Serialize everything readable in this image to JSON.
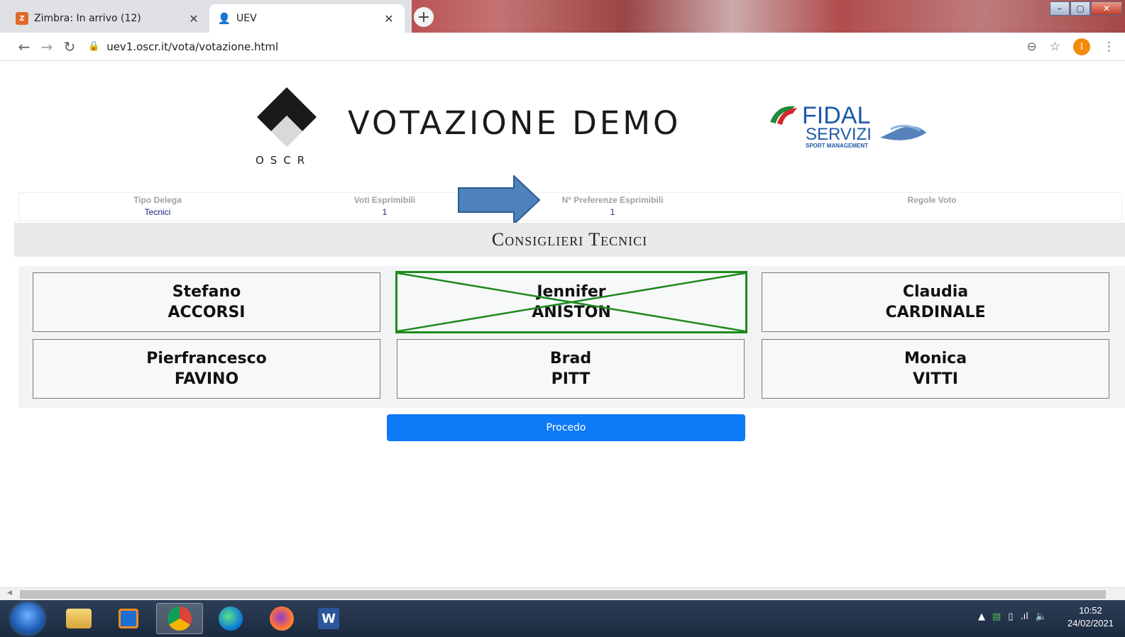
{
  "browser": {
    "tabs": [
      {
        "title": "Zimbra: In arrivo (12)",
        "active": false,
        "icon": "zimbra-icon"
      },
      {
        "title": "UEV",
        "active": true,
        "icon": "user-check-icon"
      }
    ],
    "url": "uev1.oscr.it/vota/votazione.html",
    "profile_initial": "I"
  },
  "header": {
    "logo_text": "OSCR",
    "title": "VOTAZIONE DEMO",
    "partner_logo": {
      "line1": "FIDAL",
      "line2": "SERVIZI",
      "line3": "SPORT MANAGEMENT"
    }
  },
  "info": [
    {
      "label": "Tipo Delega",
      "value": "Tecnici"
    },
    {
      "label": "Voti Esprimibili",
      "value": "1"
    },
    {
      "label": "N° Preferenze Esprimibili",
      "value": "1"
    },
    {
      "label": "Regole Voto",
      "value": ""
    }
  ],
  "section": {
    "title": "Consiglieri Tecnici"
  },
  "candidates": [
    {
      "first": "Stefano",
      "last": "ACCORSI",
      "selected": false
    },
    {
      "first": "Jennifer",
      "last": "ANISTON",
      "selected": true
    },
    {
      "first": "Claudia",
      "last": "CARDINALE",
      "selected": false
    },
    {
      "first": "Pierfrancesco",
      "last": "FAVINO",
      "selected": false
    },
    {
      "first": "Brad",
      "last": "PITT",
      "selected": false
    },
    {
      "first": "Monica",
      "last": "VITTI",
      "selected": false
    }
  ],
  "actions": {
    "proceed_label": "Procedo"
  },
  "colors": {
    "accent": "#0d7bf7",
    "selected_border": "#1e8a1e",
    "arrow": "#4f81bd"
  },
  "taskbar": {
    "apps": [
      "windows-start-icon",
      "file-explorer-icon",
      "outlook-icon",
      "chrome-icon",
      "edge-icon",
      "firefox-icon",
      "word-icon"
    ],
    "time": "10:52",
    "date": "24/02/2021"
  }
}
